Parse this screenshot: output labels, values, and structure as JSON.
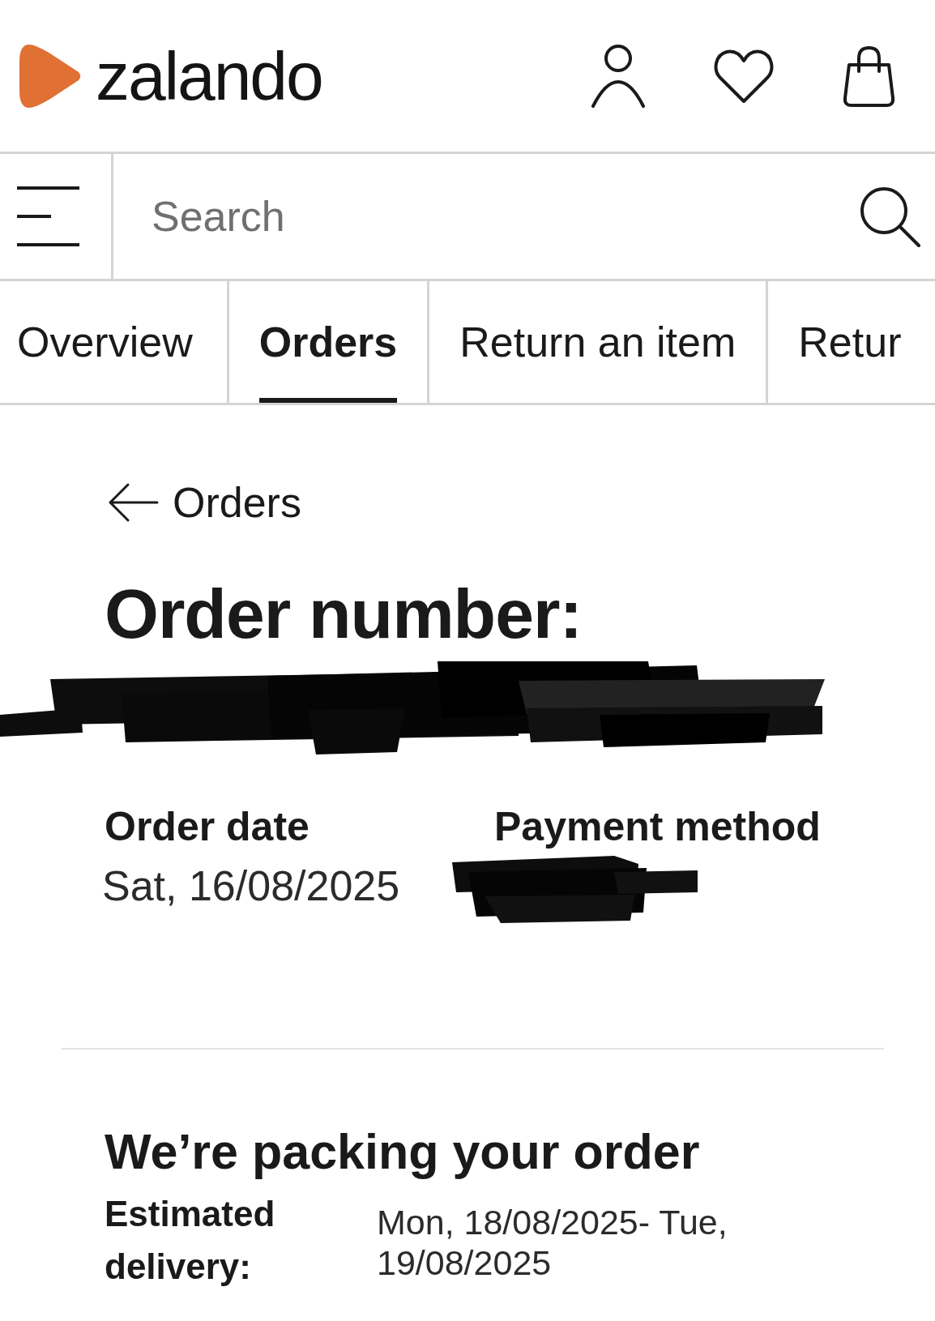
{
  "header": {
    "logo_text": "zalando"
  },
  "search": {
    "placeholder": "Search"
  },
  "tabs": [
    {
      "label": "Overview",
      "selected": false
    },
    {
      "label": "Orders",
      "selected": true
    },
    {
      "label": "Return an item",
      "selected": false
    },
    {
      "label": "Retur",
      "selected": false
    }
  ],
  "back_link": {
    "label": "Orders"
  },
  "order": {
    "heading": "Order number:",
    "number_redacted": true,
    "details": [
      {
        "label": "Order date",
        "value": "Sat, 16/08/2025",
        "redacted": false
      },
      {
        "label": "Payment method",
        "redacted": true
      }
    ]
  },
  "shipment": {
    "heading": "We’re packing your order",
    "estimate_label": "Estimated delivery:",
    "estimate_value": "Mon, 18/08/2025- Tue, 19/08/2025"
  }
}
